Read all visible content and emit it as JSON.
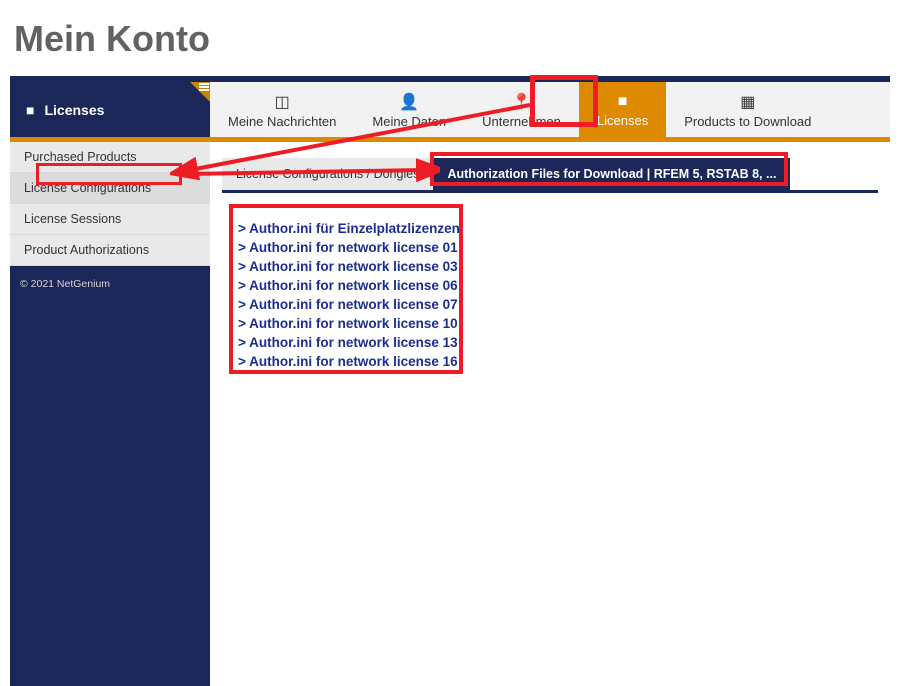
{
  "page_title": "Mein Konto",
  "tabs": {
    "primary": "Licenses",
    "items": [
      {
        "label": "Meine Nachrichten"
      },
      {
        "label": "Meine Daten"
      },
      {
        "label": "Unternehmen"
      },
      {
        "label": "Licenses"
      },
      {
        "label": "Products to Download"
      }
    ]
  },
  "sidebar": {
    "items": [
      "Purchased Products",
      "License Configurations",
      "License Sessions",
      "Product Authorizations"
    ],
    "footer": "© 2021 NetGenium"
  },
  "subtabs": {
    "items": [
      "License Configurations / Dongles",
      "Authorization Files for Download | RFEM 5, RSTAB 8, ..."
    ]
  },
  "files": [
    "> Author.ini für Einzelplatzlizenzen",
    "> Author.ini for network license 01",
    "> Author.ini for network license 03",
    "> Author.ini for network license 06",
    "> Author.ini for network license 07",
    "> Author.ini for network license 10",
    "> Author.ini for network license 13",
    "> Author.ini for network license 16"
  ]
}
